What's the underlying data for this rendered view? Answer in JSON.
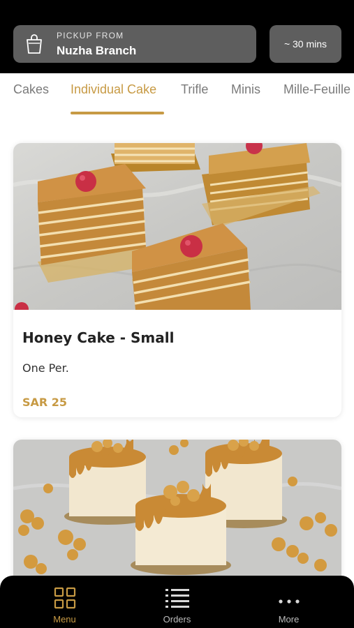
{
  "header": {
    "pickup_label": "PICKUP FROM",
    "branch": "Nuzha Branch",
    "eta": "~ 30 mins"
  },
  "tabs": [
    {
      "label": "Cakes",
      "active": false
    },
    {
      "label": "Individual Cake",
      "active": true
    },
    {
      "label": "Trifle",
      "active": false
    },
    {
      "label": "Minis",
      "active": false
    },
    {
      "label": "Mille-Feuille",
      "active": false
    }
  ],
  "products": [
    {
      "name": "Honey Cake - Small",
      "description": "One Per.",
      "price": "SAR 25"
    },
    {
      "name": "",
      "description": "",
      "price": ""
    }
  ],
  "nav": {
    "items": [
      {
        "label": "Menu",
        "icon": "grid-icon",
        "active": true
      },
      {
        "label": "Orders",
        "icon": "list-icon",
        "active": false
      },
      {
        "label": "More",
        "icon": "more-dots-icon",
        "active": false
      }
    ]
  },
  "colors": {
    "accent": "#c79a44",
    "header_bg": "#000000",
    "pill_bg": "#5e5e5e"
  }
}
